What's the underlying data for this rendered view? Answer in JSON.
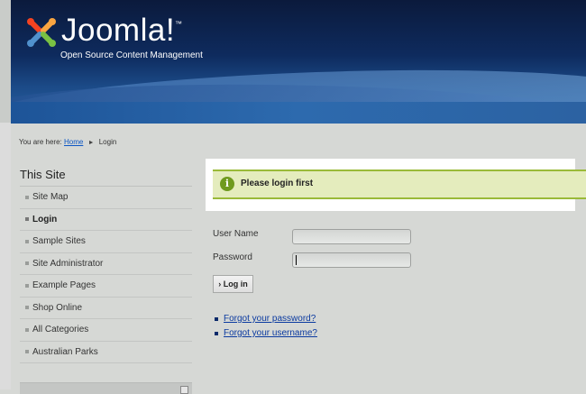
{
  "header": {
    "logo_text": "Joomla!",
    "logo_tm": "™",
    "tagline": "Open Source Content Management"
  },
  "breadcrumb": {
    "prefix": "You are here:",
    "home": "Home",
    "separator": "►",
    "current": "Login"
  },
  "sidebar": {
    "title": "This Site",
    "items": [
      {
        "label": "Site Map"
      },
      {
        "label": "Login"
      },
      {
        "label": "Sample Sites"
      },
      {
        "label": "Site Administrator"
      },
      {
        "label": "Example Pages"
      },
      {
        "label": "Shop Online"
      },
      {
        "label": "All Categories"
      },
      {
        "label": "Australian Parks"
      }
    ],
    "active_item": "Login"
  },
  "message": {
    "icon": "info-icon",
    "icon_glyph": "i",
    "text": "Please login first"
  },
  "login_form": {
    "username_label": "User Name",
    "username_value": "",
    "password_label": "Password",
    "password_value": "",
    "submit_label": "Log in",
    "submit_prefix": "›"
  },
  "links": {
    "forgot_password": "Forgot your password?",
    "forgot_username": "Forgot your username?"
  },
  "colors": {
    "header_dark": "#0b1a3c",
    "header_blue": "#2a65a6",
    "message_bg": "#e4ecbd",
    "message_border": "#9aba39",
    "link": "#0b3aa0",
    "page_bg": "#d6d8d5"
  }
}
